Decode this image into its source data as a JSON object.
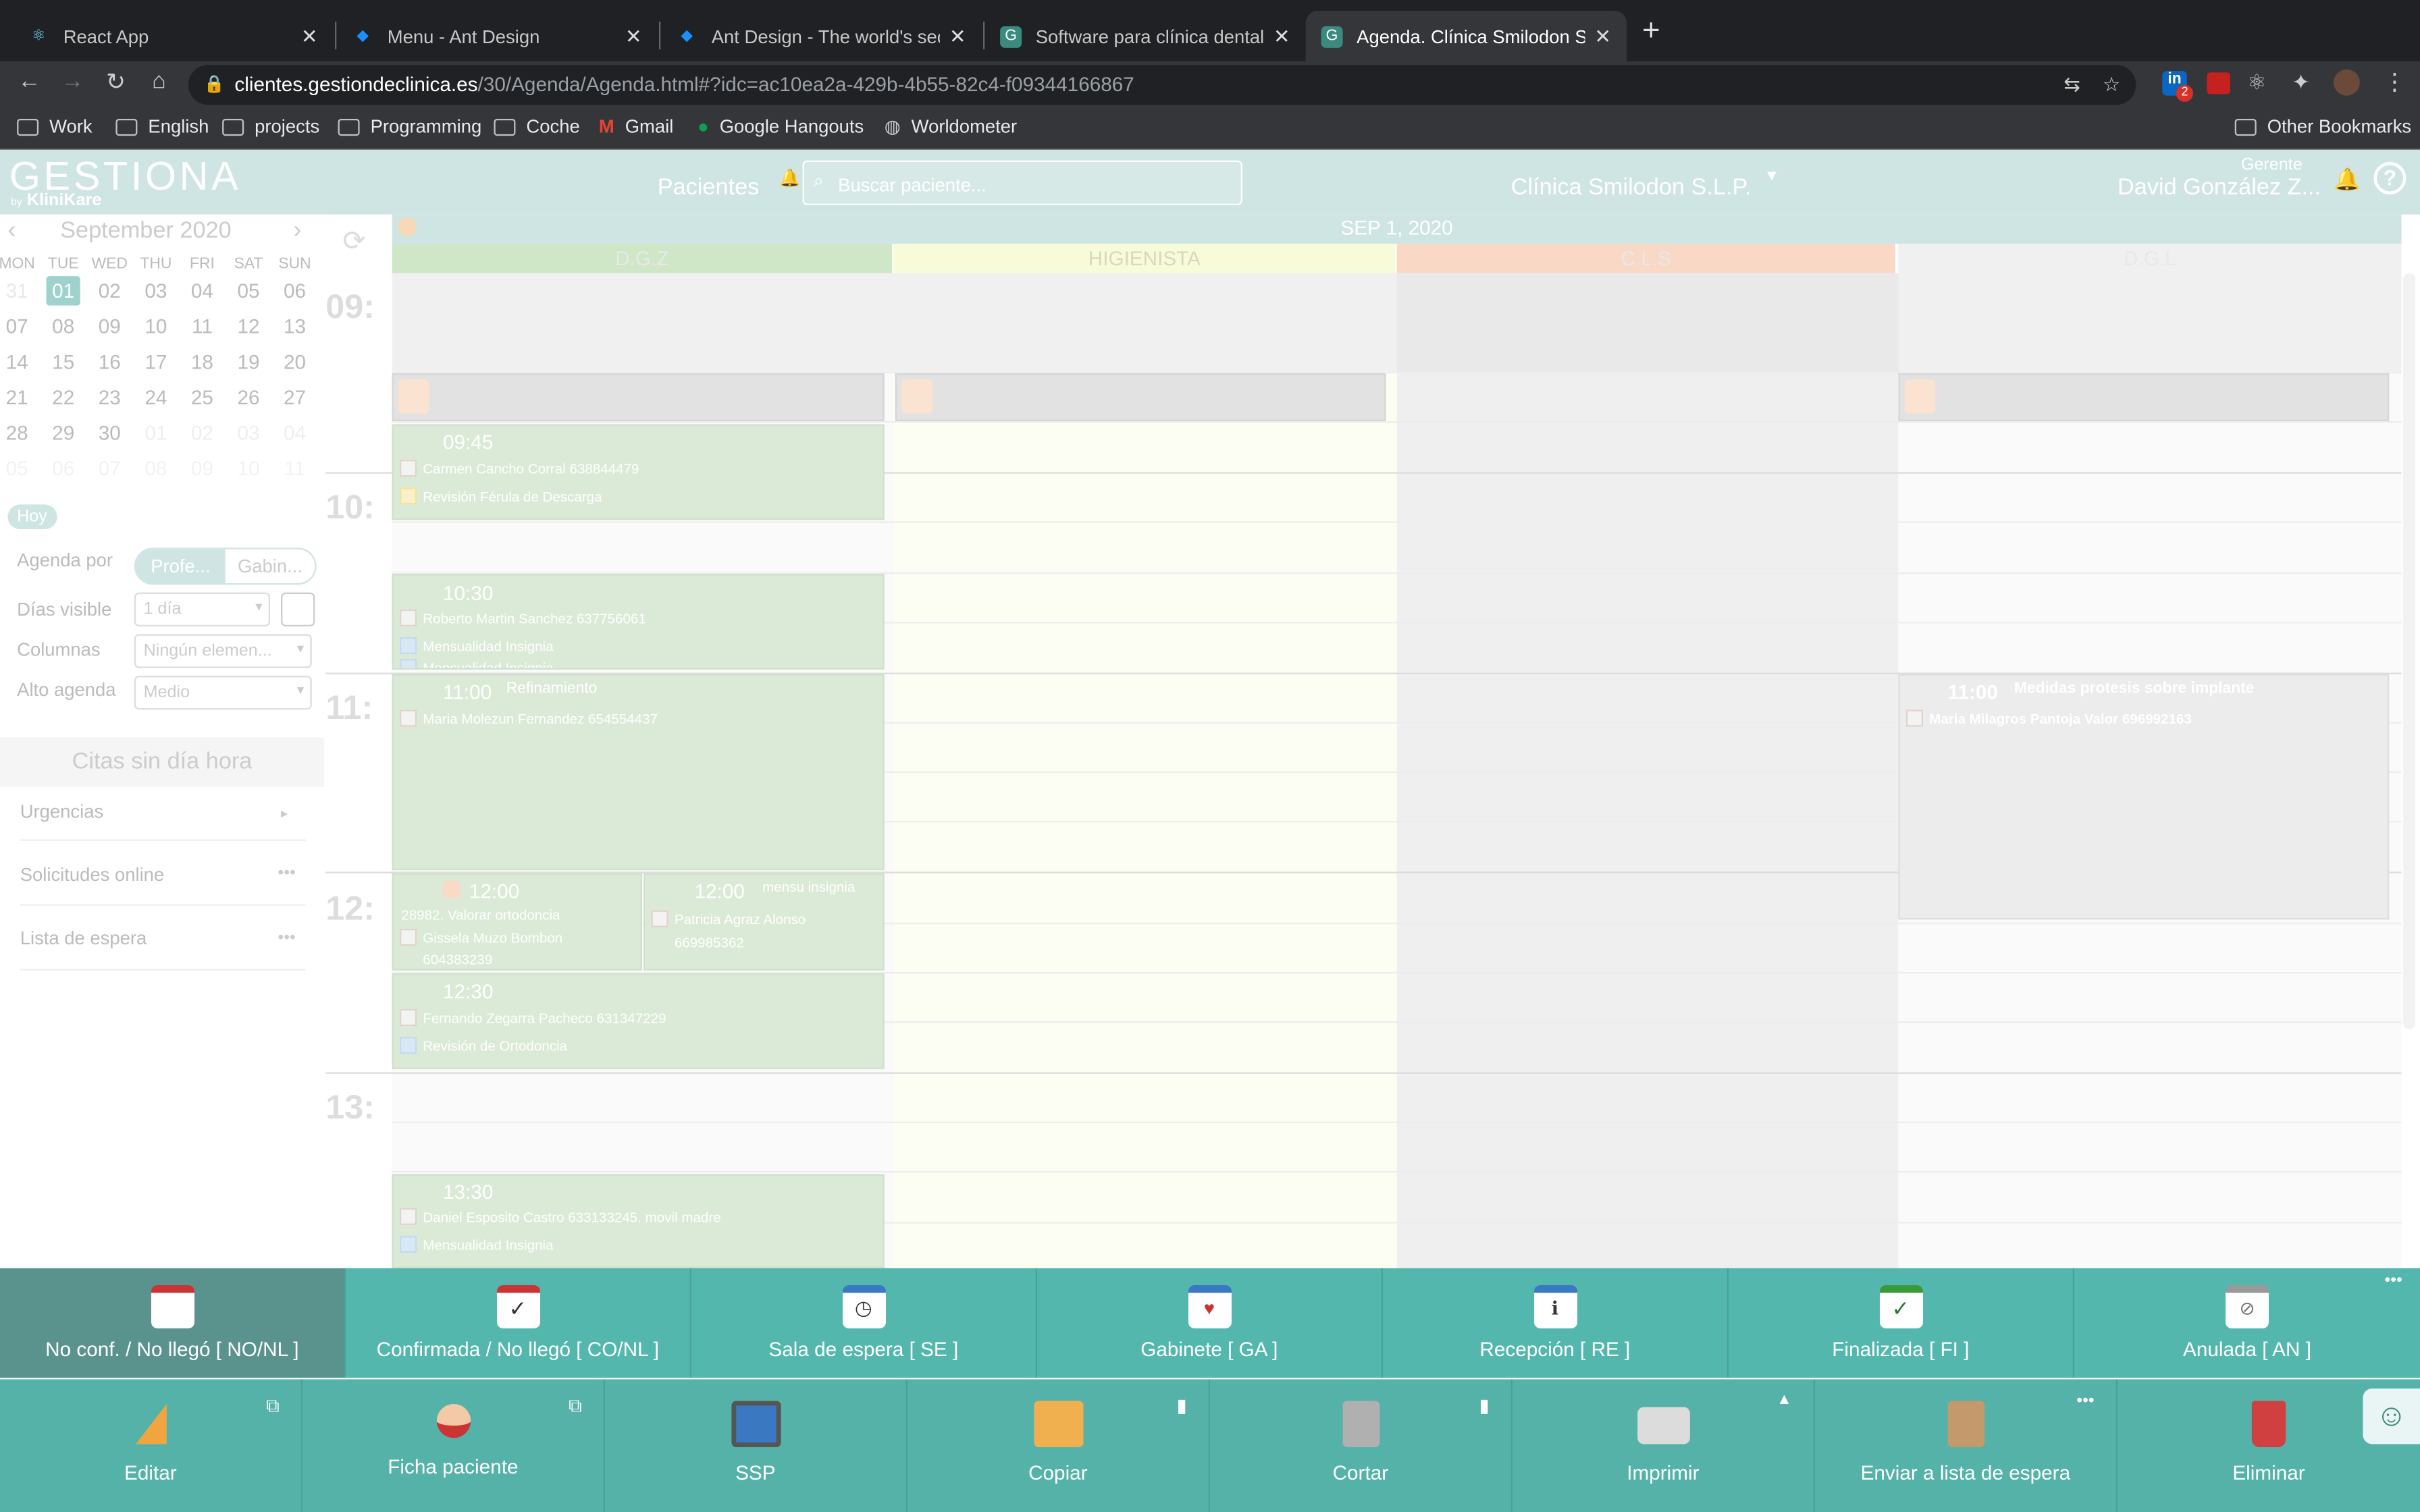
{
  "browser": {
    "tabs": [
      {
        "title": "React App",
        "icon": "react-icon"
      },
      {
        "title": "Menu - Ant Design",
        "icon": "ant-design-icon"
      },
      {
        "title": "Ant Design - The world's secon",
        "icon": "ant-design-icon"
      },
      {
        "title": "Software para clínica dental en",
        "icon": "gestiona-icon"
      },
      {
        "title": "Agenda. Clínica Smilodon S.L.P.",
        "icon": "gestiona-icon"
      }
    ],
    "url_host": "clientes.gestiondeclinica.es",
    "url_path": "/30/Agenda/Agenda.html#?idc=ac10ea2a-429b-4b55-82c4-f09344166867",
    "bookmarks": [
      "Work",
      "English",
      "projects",
      "Programming",
      "Coche",
      "Gmail",
      "Google Hangouts",
      "Worldometer"
    ],
    "other_bookmarks": "Other Bookmarks",
    "ext_badge": "2"
  },
  "app": {
    "logo": "GESTIONA",
    "logo_sub": "KliniKare",
    "logo_by": "by",
    "pacientes": "Pacientes",
    "search_placeholder": "Buscar paciente...",
    "clinic": "Clínica Smilodon S.L.P.",
    "role": "Gerente",
    "user": "David González Z...",
    "help": "?"
  },
  "sidebar": {
    "month": "September 2020",
    "weekdays": [
      "MON",
      "TUE",
      "WED",
      "THU",
      "FRI",
      "SAT",
      "SUN"
    ],
    "weeks": [
      [
        "31",
        "01",
        "02",
        "03",
        "04",
        "05",
        "06"
      ],
      [
        "07",
        "08",
        "09",
        "10",
        "11",
        "12",
        "13"
      ],
      [
        "14",
        "15",
        "16",
        "17",
        "18",
        "19",
        "20"
      ],
      [
        "21",
        "22",
        "23",
        "24",
        "25",
        "26",
        "27"
      ],
      [
        "28",
        "29",
        "30",
        "01",
        "02",
        "03",
        "04"
      ],
      [
        "05",
        "06",
        "07",
        "08",
        "09",
        "10",
        "11"
      ]
    ],
    "today": "Hoy",
    "agenda_por": "Agenda por",
    "seg_a": "Profe...",
    "seg_b": "Gabin...",
    "dias_visible": "Días visible",
    "dias_val": "1 día",
    "columnas": "Columnas",
    "columnas_val": "Ningún elemen...",
    "alto": "Alto agenda",
    "alto_val": "Medio",
    "citas": "Citas sin día hora",
    "urgencias": "Urgencias",
    "solicitudes": "Solicitudes online",
    "espera": "Lista de espera"
  },
  "agenda": {
    "date": "SEP  1,  2020",
    "columns": [
      {
        "name": "D.G.Z",
        "color": "#cfe6c7"
      },
      {
        "name": "HIGIENISTA",
        "color": "#f7fbd8"
      },
      {
        "name": "C.L.S",
        "color": "#f9d8c6"
      },
      {
        "name": "D.G.L",
        "color": "#f0f0f0"
      }
    ],
    "hours": [
      "09:",
      "10:",
      "11:",
      "12:",
      "13:"
    ],
    "appointments": [
      {
        "time": "09:45",
        "patient": "Carmen   Cancho Corral   638844479",
        "treatment": "Revisión Férula de Descarga"
      },
      {
        "time": "10:30",
        "patient": "Roberto   Martin Sanchez   637756061",
        "treatment": "Mensualidad Insignia",
        "treatment2": "Mensualidad Insignia"
      },
      {
        "time": "11:00",
        "title": "Refinamiento",
        "patient": "Maria   Molezun Fernandez   654554437"
      },
      {
        "time": "12:00",
        "title": "28982. Valorar ortodoncia",
        "patient": "Gissela   Muzo Bombon",
        "phone": "604383239"
      },
      {
        "time": "12:00",
        "title": "mensu insignia",
        "patient": "Patricia   Agraz Alonso",
        "phone": "669985362"
      },
      {
        "time": "12:30",
        "patient": "Fernando   Zegarra Pacheco   631347229",
        "treatment": "Revisión de Ortodoncia"
      },
      {
        "time": "13:30",
        "patient": "Daniel   Esposito Castro   633133245. movil madre",
        "treatment": "Mensualidad Insignia"
      },
      {
        "time": "11:00",
        "title": "Medidas protesis sobre implante",
        "patient": "Maria Milagros   Pantoja Valor   696992163"
      }
    ]
  },
  "status_bar": [
    {
      "label": "No conf. / No llegó [ NO/NL ]",
      "icon": "calendar-no-icon"
    },
    {
      "label": "Confirmada / No llegó [ CO/NL ]",
      "icon": "calendar-check-icon"
    },
    {
      "label": "Sala de espera [ SE ]",
      "icon": "calendar-clock-icon"
    },
    {
      "label": "Gabinete [ GA ]",
      "icon": "calendar-heart-icon"
    },
    {
      "label": "Recepción [ RE ]",
      "icon": "calendar-info-icon"
    },
    {
      "label": "Finalizada [ FI ]",
      "icon": "calendar-done-icon"
    },
    {
      "label": "Anulada [ AN ]",
      "icon": "calendar-cancel-icon"
    }
  ],
  "action_bar": [
    {
      "label": "Editar",
      "icon": "pencil-icon"
    },
    {
      "label": "Ficha paciente",
      "icon": "patient-icon"
    },
    {
      "label": "SSP",
      "icon": "tablet-icon"
    },
    {
      "label": "Copiar",
      "icon": "copy-icon"
    },
    {
      "label": "Cortar",
      "icon": "scissors-icon"
    },
    {
      "label": "Imprimir",
      "icon": "printer-icon"
    },
    {
      "label": "Enviar a lista de espera",
      "icon": "hourglass-icon"
    },
    {
      "label": "Eliminar",
      "icon": "trash-icon"
    }
  ]
}
